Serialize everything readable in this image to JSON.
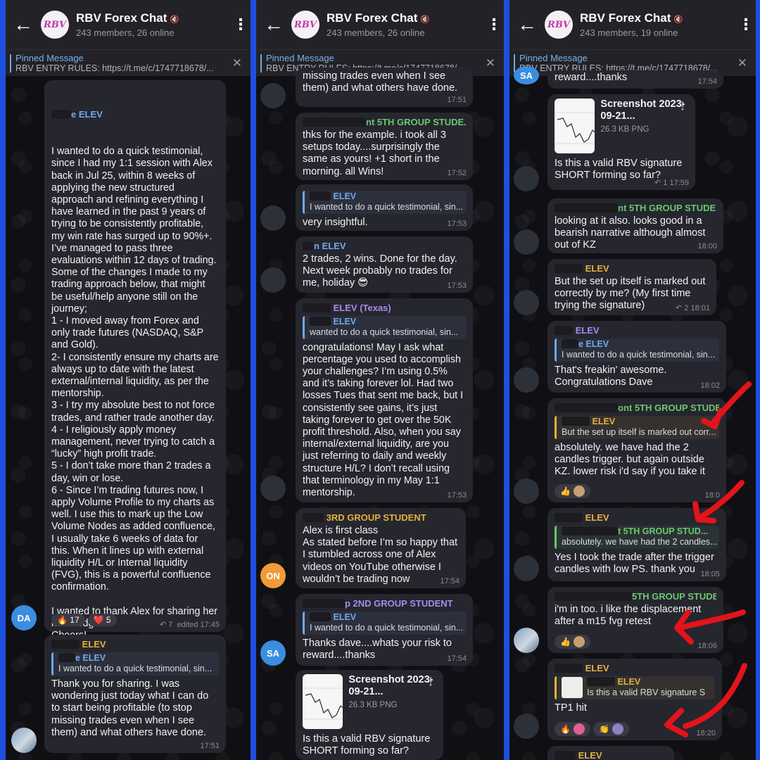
{
  "chat": {
    "title": "RBV Forex Chat",
    "logo_text": "RBV",
    "subtitle_0": "243 members, 26 online",
    "subtitle_1": "243 members, 26 online",
    "subtitle_2": "243 members, 19 online",
    "pinned_label": "Pinned Message",
    "pinned_text": "RBV ENTRY RULES: https://t.me/c/1747718678/...",
    "back_icon": "←",
    "menu_icon": "⋮",
    "close_icon": "✕"
  },
  "panel0": {
    "m1": {
      "sender": "e ELEV",
      "text": "I wanted to do a quick testimonial, since I had my 1:1 session with Alex back in Jul 25, within 8 weeks of applying the new structured approach and refining everything I have learned in the past 9 years of trying to be consistently profitable, my win rate has surged up to 90%+. I’ve managed to pass three evaluations within 12 days of trading. Some of the changes I made to my trading approach below, that might be useful/help anyone still on the journey;\n1 - I moved away from Forex and only trade futures (NASDAQ, S&P and Gold).\n2- I consistently ensure my charts are always up to date with the latest external/internal liquidity, as per the mentorship.\n3 - I try my absolute best to not force trades, and rather trade another day.\n4 - I religiously apply money management, never trying to catch a “lucky” high profit trade.\n5 - I don’t take more than 2 trades a day, win or lose.\n6 - Since I’m trading futures now, I apply Volume Profile to my charts as well. I use this to mark up the Low Volume Nodes as added confluence, I usually take 6 weeks of data for this. When it lines up with external liquidity H/L or Internal liquidity (FVG), this is a powerful confluence confirmation.\n\nI wanted to thank Alex for sharing her knowledge!\nCheers!",
      "reaction_fire": "🔥 17",
      "reaction_heart": "❤️ 5",
      "meta": "↶ 7  edited 17:45",
      "avatar": "DA"
    },
    "m2": {
      "sender": "ELEV",
      "reply_name": "e ELEV",
      "reply_text": "I wanted to do a quick testimonial, sin...",
      "text": "Thank you for sharing. I was wondering just today what I can do to start being profitable (to stop missing trades even when I see them) and what others have done.",
      "time": "17:51"
    }
  },
  "panel1": {
    "m0": {
      "text": "missing trades even when I see them) and what others have done.",
      "time": "17:51"
    },
    "m1": {
      "sender": "nt 5TH GROUP STUDE...",
      "text": "thks for the example. i took all 3 setups today....surprisingly the same as yours! +1 short in the morning. all Wins!",
      "time": "17:52"
    },
    "m2": {
      "reply_name": "ELEV",
      "reply_text": "I wanted to do a quick testimonial, sin...",
      "text": "very insightful.",
      "time": "17:53"
    },
    "m3": {
      "sender": "n ELEV",
      "text": "2 trades, 2 wins. Done for the day. Next week probably no trades for me, holiday 😎",
      "time": "17:53"
    },
    "m4": {
      "sender": "ELEV (Texas)",
      "reply_name": "ELEV",
      "reply_text": "wanted to do a quick testimonial, sin...",
      "text": "congratulations! May I ask what percentage you used to accomplish your challenges? I’m using 0.5% and it’s taking forever lol. Had two losses Tues that sent me back, but I consistently see gains, it’s just taking forever to get over the 50K profit threshold. Also, when you say internal/external liquidity, are you just referring to daily and weekly structure H/L? I don’t recall using that terminology in my May 1:1 mentorship.",
      "time": "17:53"
    },
    "m5": {
      "sender": "3RD GROUP STUDENT",
      "text": "Alex is first class\nAs stated before I’m so happy that I stumbled across one of Alex videos on YouTube otherwise I wouldn’t be trading now",
      "time": "17:54",
      "avatar": "ON"
    },
    "m6": {
      "sender": "p 2ND GROUP STUDENT",
      "reply_name": "ELEV",
      "reply_text": "I wanted to do a quick testimonial, sin...",
      "text": "Thanks dave....whats your risk to reward....thanks",
      "time": "17:54",
      "avatar": "SA"
    },
    "m7": {
      "file_name": "Screenshot 2023-09-21...",
      "file_size": "26.3 KB PNG",
      "text": "Is this a valid RBV signature SHORT forming so far?"
    }
  },
  "panel2": {
    "m0": {
      "text": "reward....thanks",
      "time": "17:54",
      "avatar": "SA"
    },
    "m1": {
      "file_name": "Screenshot 2023-09-21...",
      "file_size": "26.3 KB PNG",
      "text": "Is this a valid RBV signature SHORT forming so far?",
      "meta": "↶ 1  17:59"
    },
    "m2": {
      "sender": "nt 5TH GROUP STUDE...",
      "text": "looking at it also. looks good in a bearish narrative although almost out of KZ",
      "time": "18:00"
    },
    "m3": {
      "sender": "ELEV",
      "text": "But the set up itself is marked out correctly by me? (My first time trying the signature)",
      "meta": "↶ 2  18:01"
    },
    "m4": {
      "sender": "ELEV",
      "reply_name": "e ELEV",
      "reply_text": "I wanted to do a quick testimonial, sin...",
      "text": "That's freakin' awesome. Congratulations Dave",
      "time": "18:02"
    },
    "m5": {
      "sender": "ont 5TH GROUP STUDE",
      "reply_name": "ELEV",
      "reply_text": "But the set up itself is marked out corr...",
      "text": "absolutely. we have had the 2 candles trigger. but again outside KZ. lower risk i'd say if you take it",
      "time": "18:0"
    },
    "m6": {
      "sender": "ELEV",
      "reply_name": "t 5TH GROUP STUD...",
      "reply_text": "absolutely. we have had the 2 candles...",
      "text": "Yes I took the trade after the trigger candles with low PS. thank you",
      "time": "18:05"
    },
    "m7": {
      "sender": "5TH GROUP STUDE...",
      "text": "i'm in too. i like the displacement after a m15 fvg retest",
      "time": "18:06"
    },
    "m8": {
      "sender": "ELEV",
      "reply_name": "ELEV",
      "reply_text": "Is this a valid RBV signature S",
      "text": "TP1 hit",
      "time": "18:20"
    },
    "m9": {
      "sender": "ELEV"
    }
  },
  "colors": {
    "frame": "#1f4fe0",
    "bubble": "#26262e",
    "header": "#222228",
    "annotation_arrow": "#e3141b"
  },
  "icons": [
    "back-arrow-icon",
    "more-vert-icon",
    "close-icon",
    "mute-icon",
    "fire-emoji",
    "heart-emoji",
    "thumbs-up-emoji",
    "clap-emoji",
    "reply-count-icon"
  ]
}
